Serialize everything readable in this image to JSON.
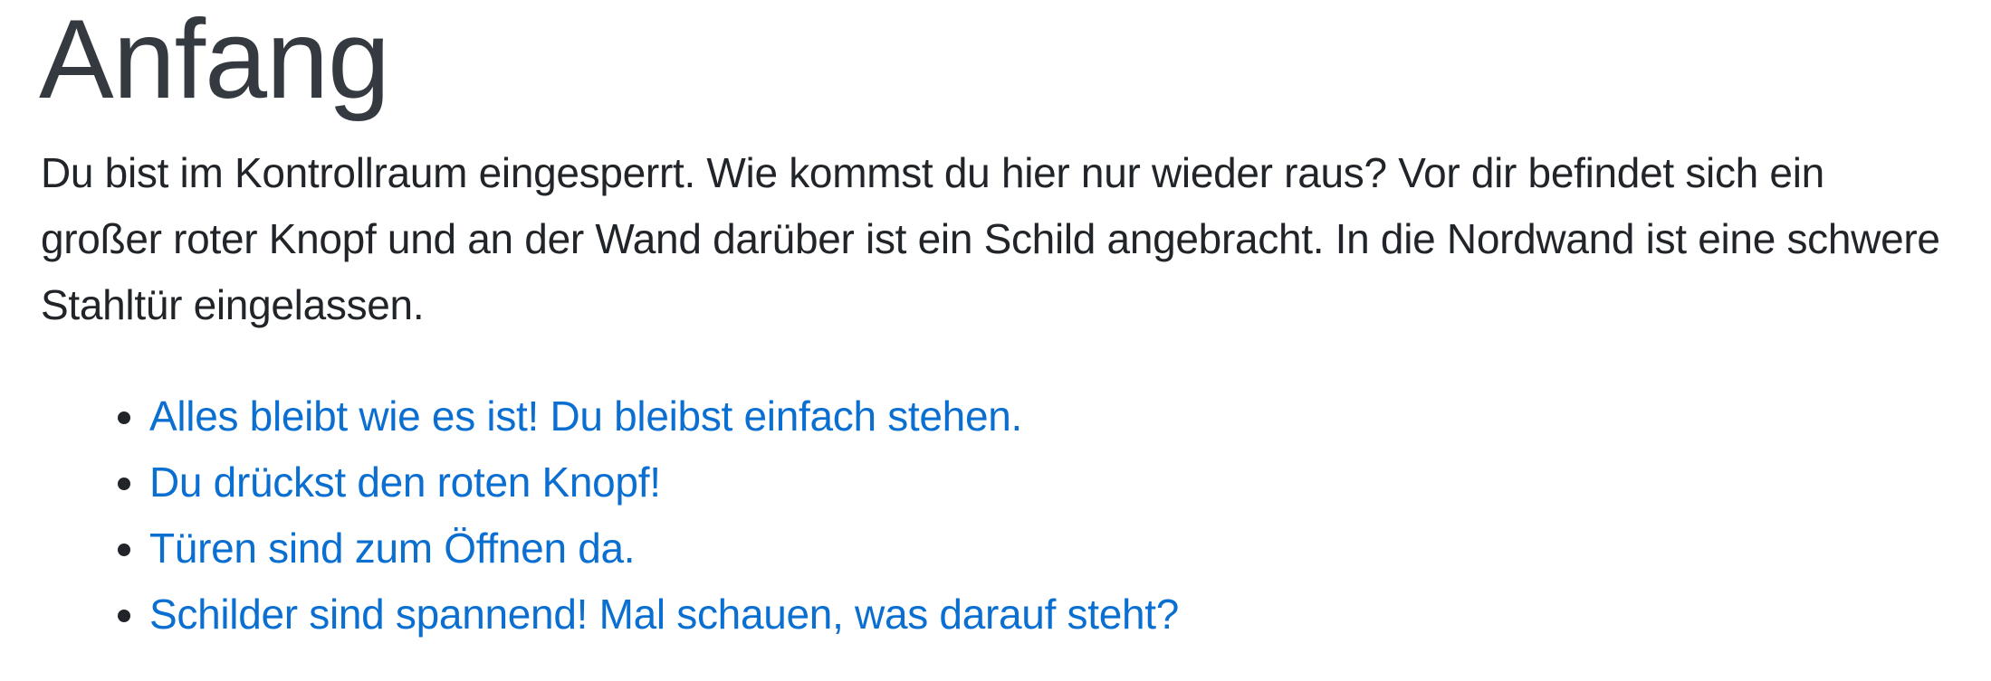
{
  "scene": {
    "title": "Anfang",
    "description": "Du bist im Kontrollraum eingesperrt. Wie kommst du hier nur wieder raus? Vor dir befindet sich ein großer roter Knopf und an der Wand darüber ist ein Schild angebracht. In die Nordwand ist eine schwere Stahltür eingelassen.",
    "choices": [
      {
        "label": "Alles bleibt wie es ist! Du bleibst einfach stehen."
      },
      {
        "label": "Du drückst den roten Knopf!"
      },
      {
        "label": "Türen sind zum Öffnen da."
      },
      {
        "label": "Schilder sind spannend! Mal schauen, was darauf steht?"
      }
    ]
  },
  "colors": {
    "heading": "#343a40",
    "text": "#212529",
    "link": "#0a6fd1",
    "background": "#ffffff"
  }
}
